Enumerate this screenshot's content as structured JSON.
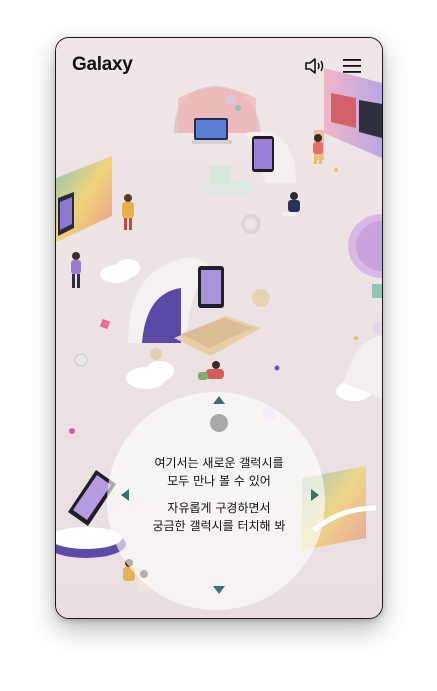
{
  "brand": {
    "name": "Galaxy"
  },
  "icons": {
    "sound": "speaker-icon",
    "menu": "hamburger-menu-icon"
  },
  "guide": {
    "line1": "여기서는 새로운 갤럭시를",
    "line2": "모두 만나 볼 수 있어",
    "line3": "자유롭게 구경하면서",
    "line4": "궁금한 갤럭시를 터치해 봐"
  },
  "colors": {
    "background": "#ede4e6",
    "arrow": "#3c6e6b",
    "knob": "#a9a9a9"
  }
}
